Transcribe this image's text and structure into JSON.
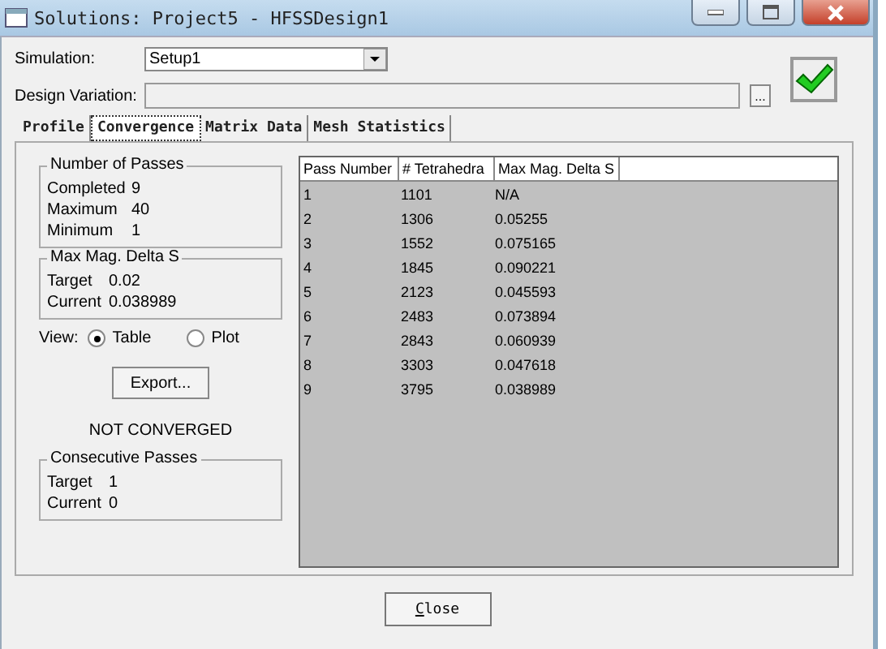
{
  "window": {
    "title": "Solutions: Project5 - HFSSDesign1"
  },
  "simulation": {
    "label": "Simulation:",
    "value": "Setup1"
  },
  "design_variation": {
    "label": "Design Variation:",
    "button": "..."
  },
  "tabs": [
    {
      "label": "Profile",
      "selected": false
    },
    {
      "label": "Convergence",
      "selected": true
    },
    {
      "label": "Matrix Data",
      "selected": false
    },
    {
      "label": "Mesh Statistics",
      "selected": false
    }
  ],
  "groups": [
    {
      "title": "Number of Passes",
      "rows": [
        [
          "Completed",
          "9"
        ],
        [
          "Maximum",
          "40"
        ],
        [
          "Minimum",
          "1"
        ]
      ]
    },
    {
      "title": "Max Mag. Delta S",
      "rows": [
        [
          "Target",
          "0.02"
        ],
        [
          "Current",
          "0.038989"
        ]
      ]
    }
  ],
  "view": {
    "label": "View:",
    "options": [
      {
        "label": "Table",
        "selected": true
      },
      {
        "label": "Plot",
        "selected": false
      }
    ]
  },
  "export_button": "Export...",
  "status": "NOT CONVERGED",
  "consecutive": {
    "title": "Consecutive Passes",
    "rows": [
      [
        "Target",
        "1"
      ],
      [
        "Current",
        "0"
      ]
    ]
  },
  "table": {
    "columns": [
      "Pass Number",
      "# Tetrahedra",
      "Max Mag. Delta S"
    ],
    "rows": [
      [
        "1",
        "1101",
        "N/A"
      ],
      [
        "2",
        "1306",
        "0.05255"
      ],
      [
        "3",
        "1552",
        "0.075165"
      ],
      [
        "4",
        "1845",
        "0.090221"
      ],
      [
        "5",
        "2123",
        "0.045593"
      ],
      [
        "6",
        "2483",
        "0.073894"
      ],
      [
        "7",
        "2843",
        "0.060939"
      ],
      [
        "8",
        "3303",
        "0.047618"
      ],
      [
        "9",
        "3795",
        "0.038989"
      ]
    ]
  },
  "close_button": "Close"
}
